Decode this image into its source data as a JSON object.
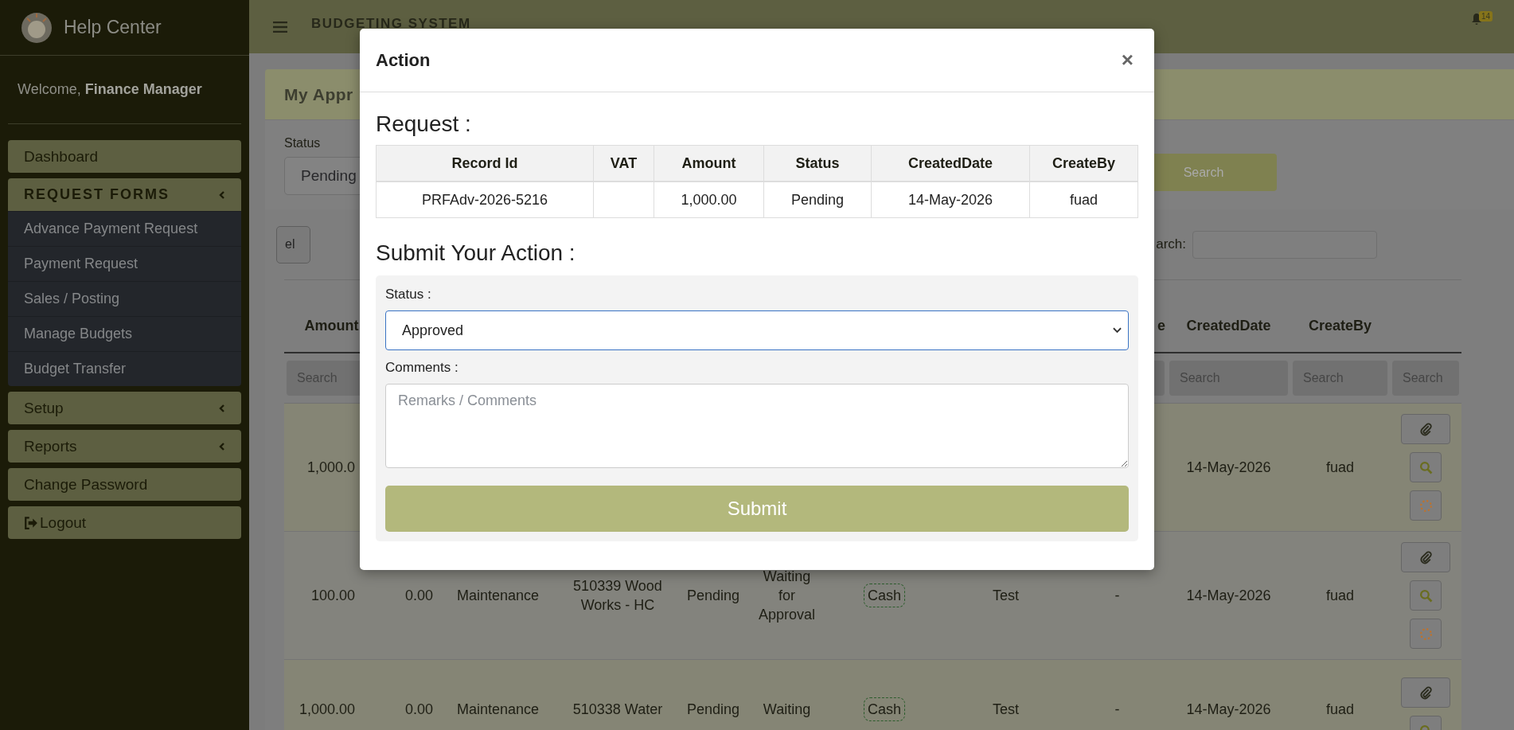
{
  "sidebar": {
    "brand": "Help Center",
    "welcome": "Welcome, **Finance Manager**",
    "items": [
      {
        "label": "Dashboard",
        "kind": "link"
      },
      {
        "label": "REQUEST FORMS",
        "kind": "group",
        "expanded": true,
        "children": [
          {
            "label": "Advance Payment Request"
          },
          {
            "label": "Payment Request"
          },
          {
            "label": "Sales / Posting"
          },
          {
            "label": "Manage Budgets"
          },
          {
            "label": "Budget Transfer"
          }
        ]
      },
      {
        "label": "Setup",
        "kind": "group",
        "expanded": false
      },
      {
        "label": "Reports",
        "kind": "group",
        "expanded": false
      },
      {
        "label": "Change Password",
        "kind": "link"
      },
      {
        "label": "Logout",
        "kind": "logout"
      }
    ]
  },
  "topbar": {
    "title": "BUDGETING SYSTEM",
    "notification_count": "14"
  },
  "panel": {
    "title": "My Appr",
    "filter_label": "Status",
    "filter_value": "Pending",
    "search_button": "Search",
    "export_button": "el",
    "search_label": "arch:"
  },
  "table": {
    "headers": [
      "Amount"
    ],
    "trailing_headers": [
      "e",
      "CreatedDate",
      "CreateBy"
    ],
    "filters": [
      "Search"
    ],
    "trailing_filters": [
      "Search",
      "Search",
      "Search"
    ],
    "rows": [
      {
        "cells": [
          "1,000.0"
        ],
        "trailing_cells": [
          "14-May-2026",
          "fuad"
        ]
      },
      {
        "cells": [
          "100.00",
          "0.00",
          "Maintenance",
          "510339 Wood Works - HC",
          "Pending",
          "Waiting for Approval",
          {
            "text": "Cash",
            "kind": "tag"
          },
          "Test",
          "-",
          "14-May-2026",
          "fuad"
        ]
      },
      {
        "cells": [
          "1,000.00",
          "0.00",
          "Maintenance",
          "510338 Water",
          "Pending",
          "Waiting",
          {
            "text": "Cash",
            "kind": "tag"
          },
          "Test",
          "-",
          "14-May-2026",
          "fuad"
        ]
      }
    ]
  },
  "modal": {
    "title": "Action",
    "close": "×",
    "request_heading": "Request :",
    "request_columns": [
      "Record Id",
      "VAT",
      "Amount",
      "Status",
      "CreatedDate",
      "CreateBy"
    ],
    "request_rows": [
      [
        "PRFAdv-2026-5216",
        "",
        "1,000.00",
        "Pending",
        "14-May-2026",
        "fuad"
      ]
    ],
    "action_heading": "Submit Your Action :",
    "status_label": "Status :",
    "status_value": "Approved",
    "comments_label": "Comments :",
    "comments_placeholder": "Remarks / Comments",
    "submit": "Submit"
  }
}
